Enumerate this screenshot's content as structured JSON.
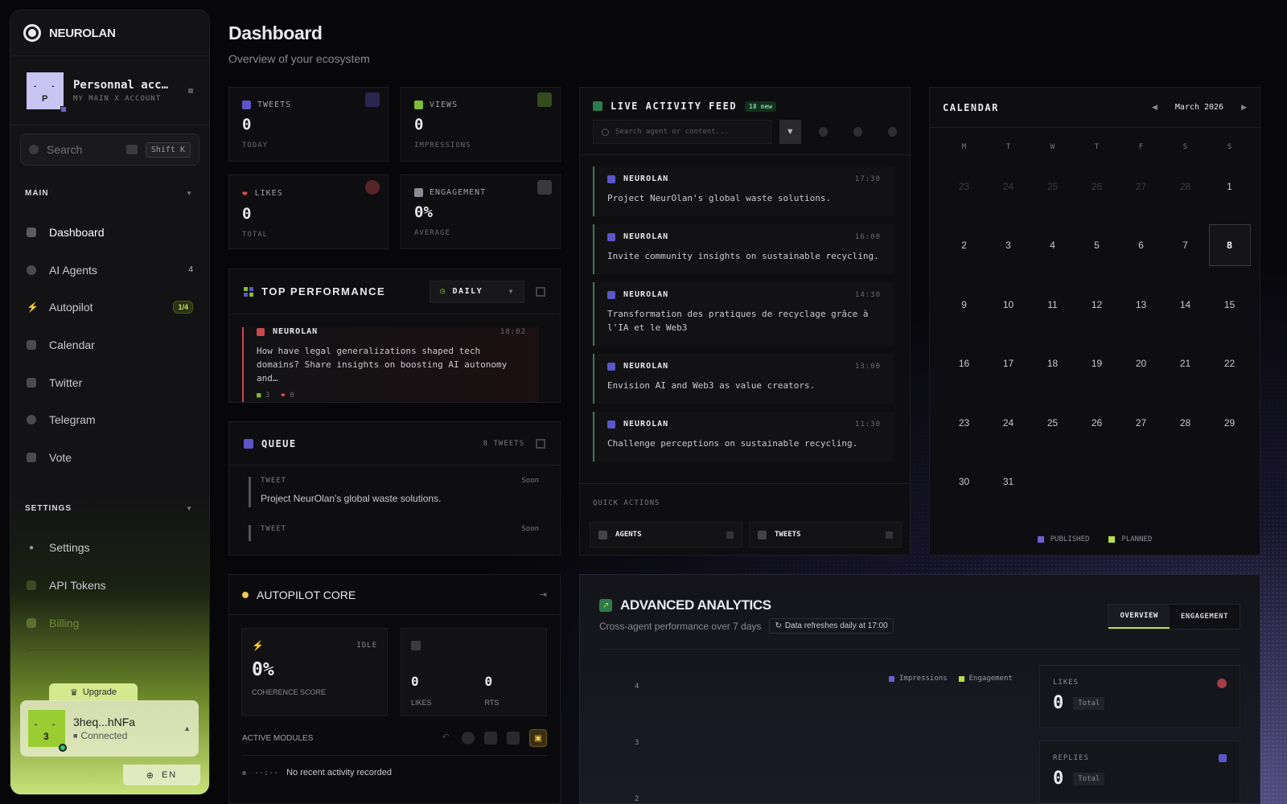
{
  "brand": {
    "name": "NEUROLAN"
  },
  "account": {
    "name": "Personnal acc…",
    "subtitle": "MY MAIN X ACCOUNT",
    "avatar_letter": "P"
  },
  "search": {
    "placeholder": "Search",
    "shortcut": "Shift K"
  },
  "sidebar": {
    "main_section": "MAIN",
    "items": [
      {
        "label": "Dashboard",
        "icon": "home-icon"
      },
      {
        "label": "AI Agents",
        "icon": "gear-icon",
        "count": "4"
      },
      {
        "label": "Autopilot",
        "icon": "bolt-icon",
        "badge": "1/4"
      },
      {
        "label": "Calendar",
        "icon": "calendar-icon"
      },
      {
        "label": "Twitter",
        "icon": "twitter-icon"
      },
      {
        "label": "Telegram",
        "icon": "telegram-icon"
      },
      {
        "label": "Vote",
        "icon": "vote-icon"
      }
    ],
    "settings_section": "SETTINGS",
    "settings_items": [
      {
        "label": "Settings",
        "icon": "dot-icon"
      },
      {
        "label": "API Tokens",
        "icon": "grid-icon"
      },
      {
        "label": "Billing",
        "icon": "card-icon"
      }
    ],
    "upgrade": "Upgrade",
    "user": {
      "name": "3heq...hNFa",
      "status": "Connected",
      "avatar_letter": "3"
    },
    "language": "EN"
  },
  "page": {
    "title": "Dashboard",
    "subtitle": "Overview of your ecosystem"
  },
  "stats": [
    {
      "label": "TWEETS",
      "value": "0",
      "foot": "TODAY",
      "color": "#5b55c8"
    },
    {
      "label": "VIEWS",
      "value": "0",
      "foot": "IMPRESSIONS",
      "color": "#7dbb3a"
    },
    {
      "label": "LIKES",
      "value": "0",
      "foot": "TOTAL",
      "color": "#e0505a"
    },
    {
      "label": "ENGAGEMENT",
      "value": "0%",
      "foot": "AVERAGE",
      "color": "#8a8a92"
    }
  ],
  "top_performance": {
    "title": "TOP PERFORMANCE",
    "filter": "DAILY",
    "item": {
      "author": "NEUROLAN",
      "time": "18:02",
      "text": "How have legal generalizations shaped tech domains? Share insights on boosting AI autonomy and…",
      "views": "3",
      "likes": "0"
    }
  },
  "queue": {
    "title": "QUEUE",
    "count": "8 TWEETS",
    "items": [
      {
        "type": "TWEET",
        "when": "Soon",
        "text": "Project NeurOlan's global waste solutions."
      },
      {
        "type": "TWEET",
        "when": "Soon",
        "text": ""
      }
    ]
  },
  "autopilot": {
    "title": "AUTOPILOT CORE",
    "state": "IDLE",
    "score": "0%",
    "score_label": "COHERENCE SCORE",
    "likes": "0",
    "likes_label": "LIKES",
    "rts": "0",
    "rts_label": "RTS",
    "modules_label": "ACTIVE MODULES",
    "recent_time": "--:--",
    "recent_text": "No recent activity recorded"
  },
  "feed": {
    "title": "LIVE ACTIVITY FEED",
    "badge": "18 new",
    "search_placeholder": "Search agent or content...",
    "items": [
      {
        "author": "NEUROLAN",
        "time": "17:30",
        "text": "Project NeurOlan's global waste solutions."
      },
      {
        "author": "NEUROLAN",
        "time": "16:00",
        "text": "Invite community insights on sustainable recycling."
      },
      {
        "author": "NEUROLAN",
        "time": "14:30",
        "text": "Transformation des pratiques de recyclage grâce à l'IA et le Web3"
      },
      {
        "author": "NEUROLAN",
        "time": "13:00",
        "text": "Envision AI and Web3 as value creators."
      },
      {
        "author": "NEUROLAN",
        "time": "11:30",
        "text": "Challenge perceptions on sustainable recycling."
      }
    ],
    "quick_actions_label": "QUICK ACTIONS",
    "quick_actions": [
      "AGENTS",
      "TWEETS"
    ]
  },
  "calendar": {
    "title": "CALENDAR",
    "month": "March 2026",
    "weekdays": [
      "M",
      "T",
      "W",
      "T",
      "F",
      "S",
      "S"
    ],
    "days": [
      [
        "23",
        "24",
        "25",
        "26",
        "27",
        "28",
        "1"
      ],
      [
        "2",
        "3",
        "4",
        "5",
        "6",
        "7",
        "8"
      ],
      [
        "9",
        "10",
        "11",
        "12",
        "13",
        "14",
        "15"
      ],
      [
        "16",
        "17",
        "18",
        "19",
        "20",
        "21",
        "22"
      ],
      [
        "23",
        "24",
        "25",
        "26",
        "27",
        "28",
        "29"
      ],
      [
        "30",
        "31",
        "",
        "",
        "",
        "",
        ""
      ]
    ],
    "today": "8",
    "legend": [
      {
        "label": "PUBLISHED",
        "color": "#6c5fd1"
      },
      {
        "label": "PLANNED",
        "color": "#b6e04a"
      }
    ]
  },
  "analytics": {
    "title": "ADVANCED ANALYTICS",
    "subtitle": "Cross-agent performance over 7 days",
    "refresh_note": "Data refreshes daily at 17:00",
    "tabs": [
      "OVERVIEW",
      "ENGAGEMENT"
    ],
    "legend": [
      {
        "label": "Impressions",
        "color": "#6c5fd1"
      },
      {
        "label": "Engagement",
        "color": "#b6e04a"
      }
    ],
    "y_ticks": [
      "4",
      "3",
      "2"
    ],
    "likes": {
      "label": "LIKES",
      "value": "0",
      "unit": "Total"
    },
    "replies": {
      "label": "REPLIES",
      "value": "0",
      "unit": "Total"
    }
  }
}
